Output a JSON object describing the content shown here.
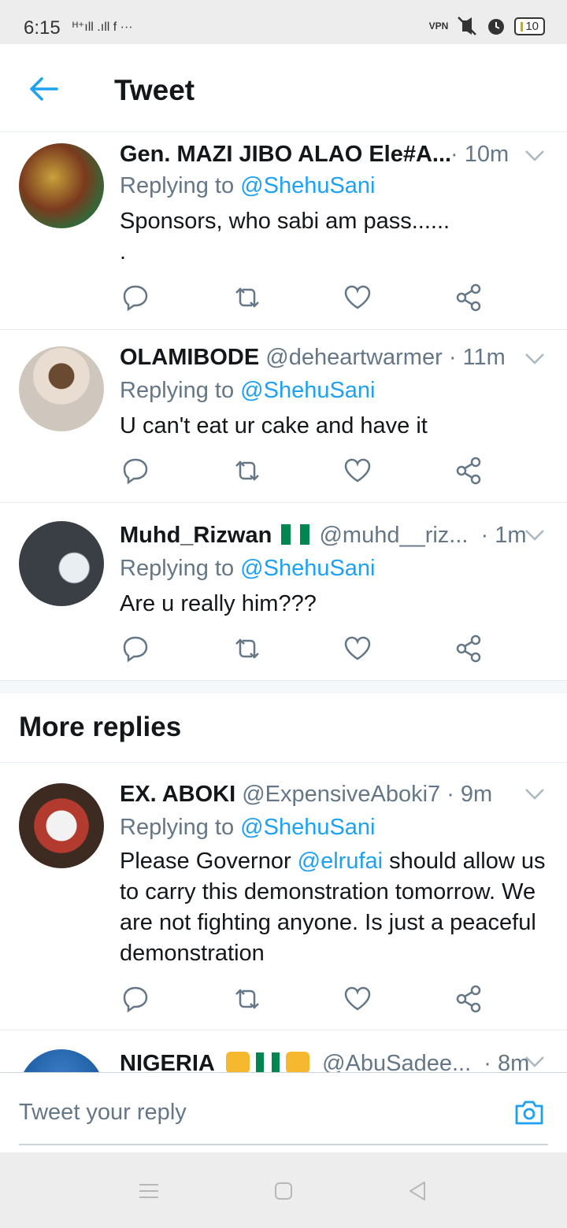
{
  "status_bar": {
    "time": "6:15",
    "left_icons": "ᴴ⁺ıll .ıll f ···",
    "vpn": "VPN",
    "battery": "10"
  },
  "header": {
    "title": "Tweet"
  },
  "tweets": [
    {
      "name": "Gen. MAZI JIBO ALAO Ele#A...",
      "handle": "",
      "time": "· 10m",
      "replying_label": "Replying to",
      "replying_to": "@ShehuSani",
      "text_line1": "Sponsors, who sabi am pass......",
      "text_line2": "."
    },
    {
      "name": "OLAMIBODE",
      "handle": "@deheartwarmer",
      "time": "· 11m",
      "replying_label": "Replying to",
      "replying_to": "@ShehuSani",
      "text": "U can't eat ur cake and have it"
    },
    {
      "name": "Muhd_Rizwan",
      "handle": "@muhd__riz...",
      "time": "· 1m",
      "replying_label": "Replying to",
      "replying_to": "@ShehuSani",
      "text": "Are u really him???"
    }
  ],
  "more_replies": {
    "title": "More replies",
    "items": [
      {
        "name": "EX. ABOKI",
        "handle": "@ExpensiveAboki7",
        "time": "· 9m",
        "replying_label": "Replying to",
        "replying_to": "@ShehuSani",
        "text_pre": "Please Governor ",
        "text_mention": "@elrufai",
        "text_post": " should allow us to carry this demonstration tomorrow. We are not fighting anyone. Is just a peaceful demonstration"
      },
      {
        "name": "NIGERIA",
        "handle": "@AbuSadee...",
        "time": "· 8m"
      }
    ]
  },
  "reply_bar": {
    "placeholder": "Tweet your reply"
  },
  "colors": {
    "accent": "#1da1f2",
    "secondary_text": "#657786",
    "primary_text": "#14171a"
  }
}
